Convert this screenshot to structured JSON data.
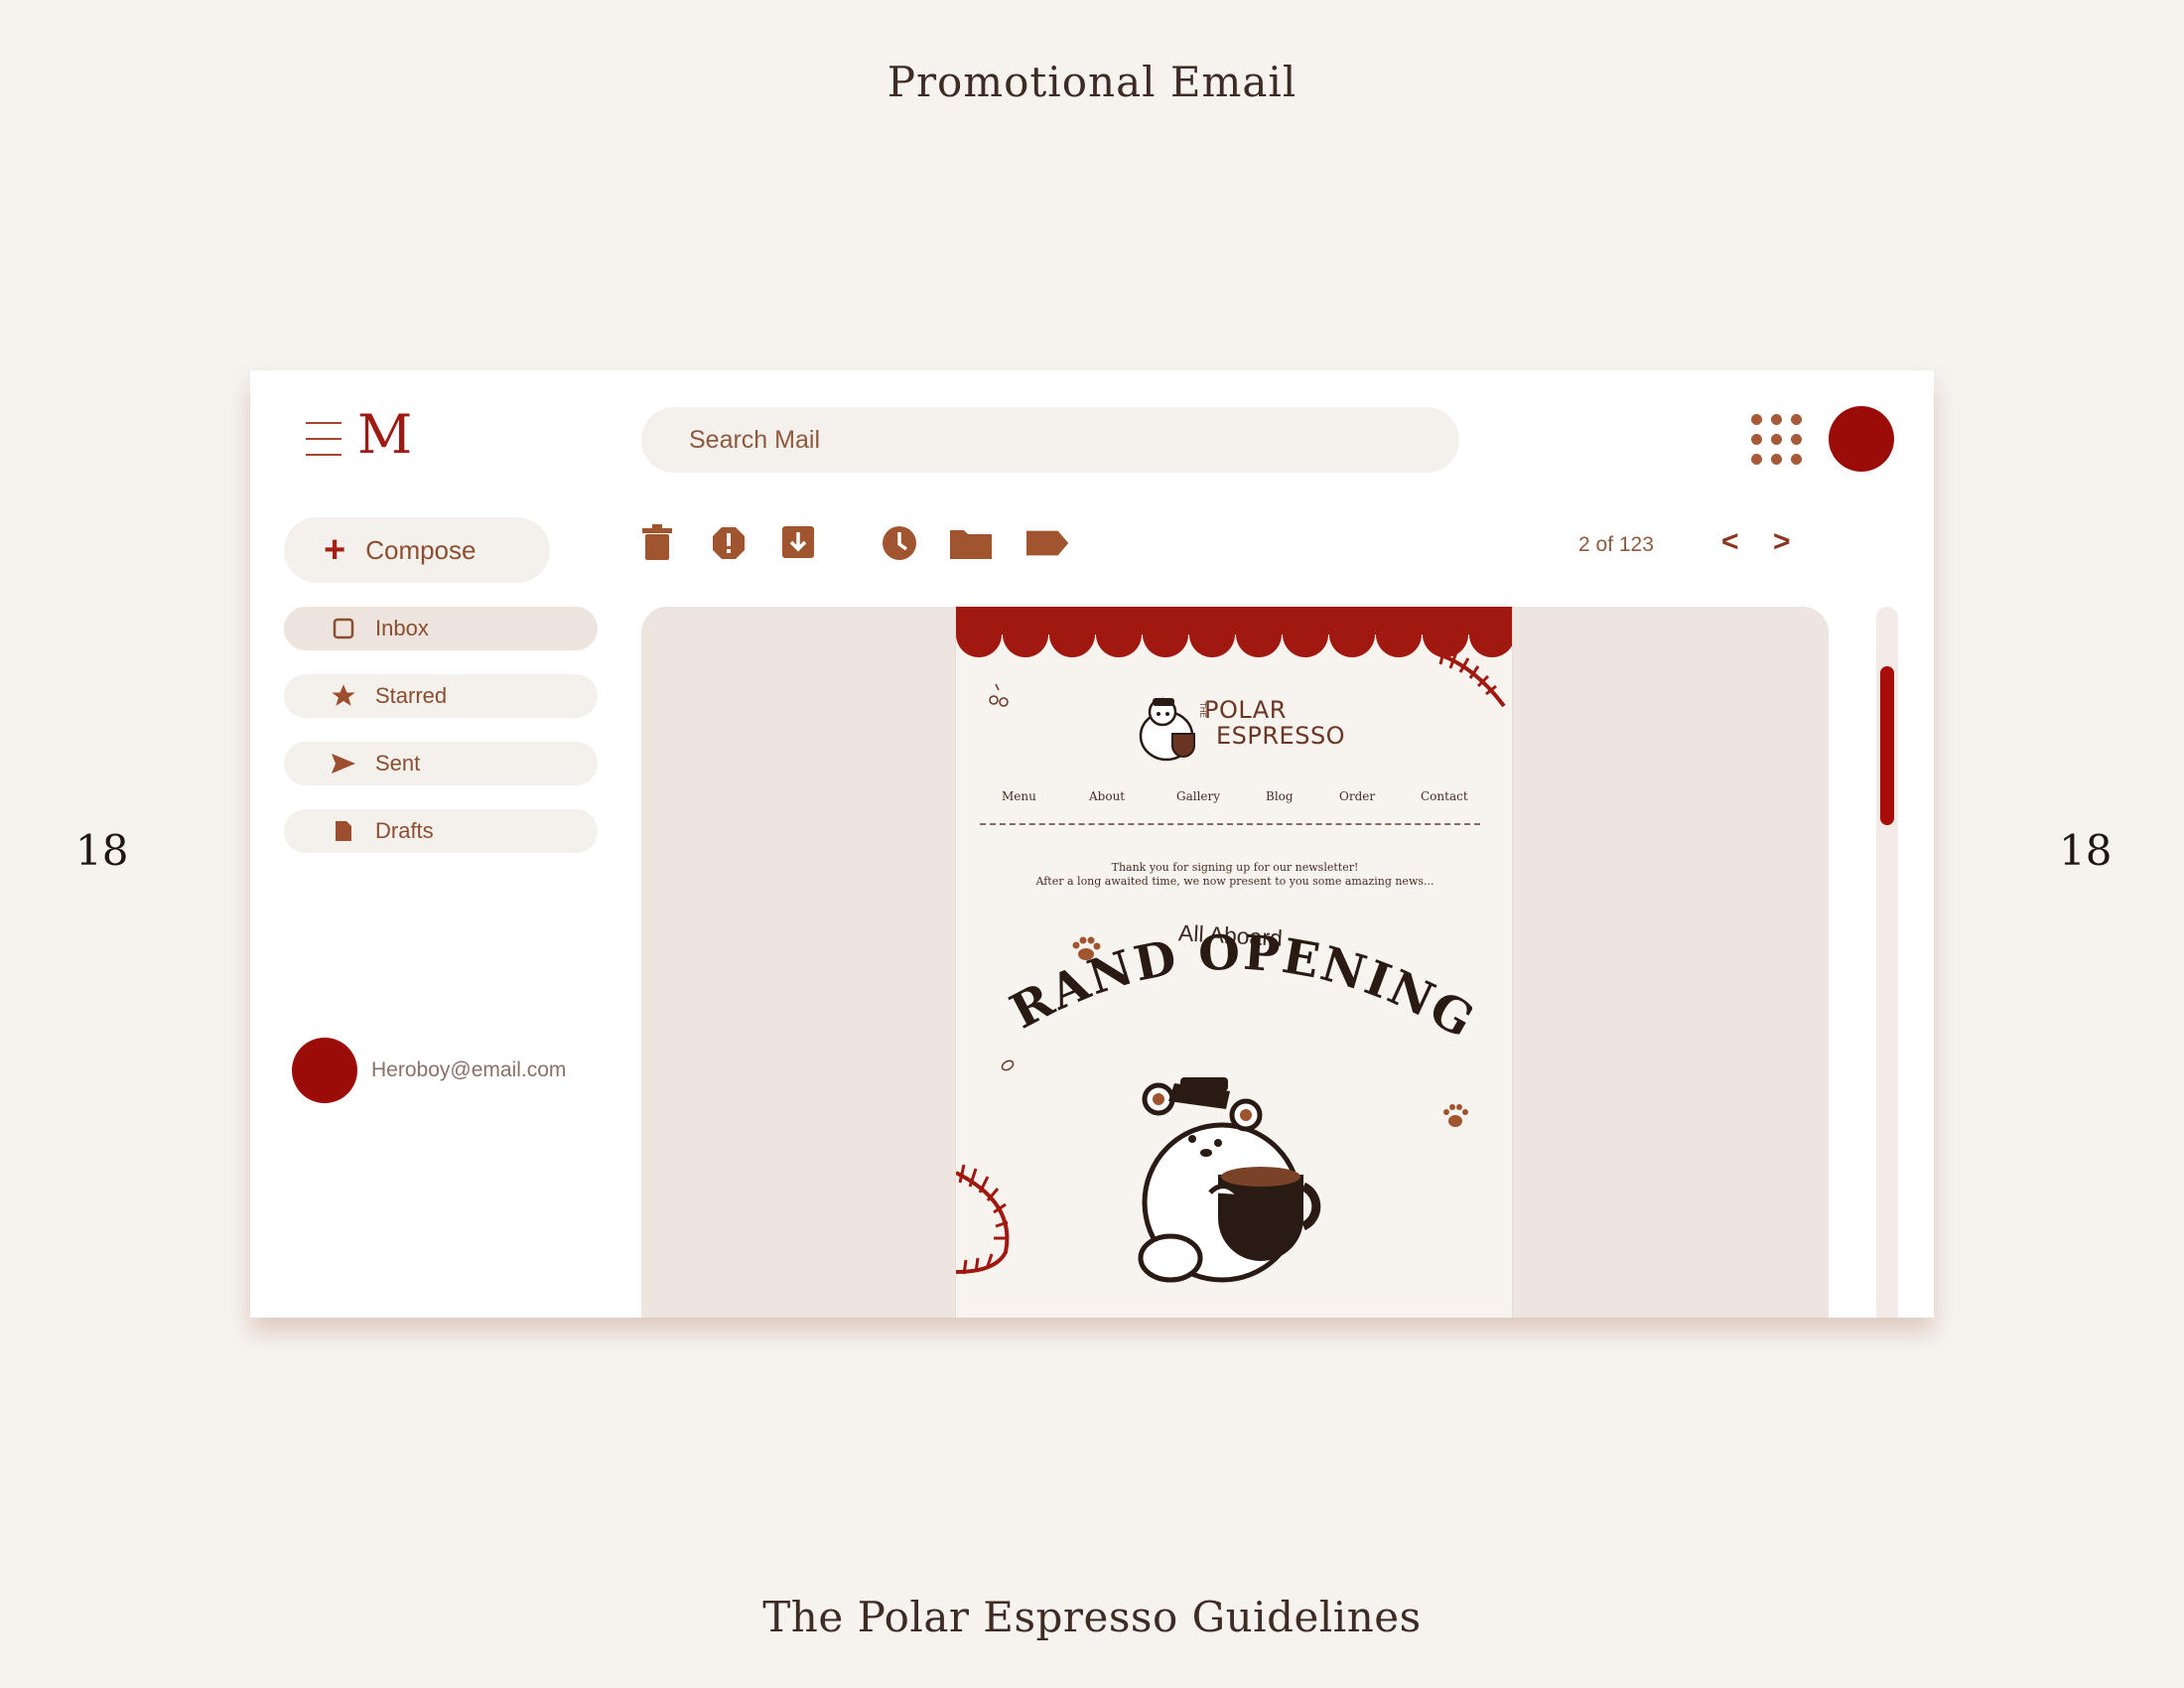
{
  "page": {
    "title": "Promotional Email",
    "footer": "The Polar Espresso Guidelines",
    "page_number_left": "18",
    "page_number_right": "18"
  },
  "app": {
    "logo": "M",
    "search_placeholder": "Search Mail",
    "compose_label": "Compose",
    "nav": [
      {
        "label": "Inbox",
        "icon": "inbox-icon"
      },
      {
        "label": "Starred",
        "icon": "star-icon"
      },
      {
        "label": "Sent",
        "icon": "send-icon"
      },
      {
        "label": "Drafts",
        "icon": "draft-icon"
      }
    ],
    "account_email": "Heroboy@email.com",
    "toolbar_icons": [
      "trash-icon",
      "report-icon",
      "archive-icon",
      "snooze-icon",
      "folder-icon",
      "label-icon"
    ],
    "pagination": "2 of 123",
    "prev": "<",
    "next": ">"
  },
  "email": {
    "brand_line1": "POLAR",
    "brand_line2": "ESPRESSO",
    "brand_the": "THE",
    "nav": [
      "Menu",
      "About",
      "Gallery",
      "Blog",
      "Order",
      "Contact"
    ],
    "thanks_line1": "Thank you for signing up for our newsletter!",
    "thanks_line2": "After a long awaited time, we now present to you some amazing news...",
    "all_aboard": "All Aboard",
    "headline": "GRAND OPENING!"
  },
  "colors": {
    "accent": "#9b0c08",
    "brown": "#a65a38",
    "background": "#f6f3ef"
  }
}
